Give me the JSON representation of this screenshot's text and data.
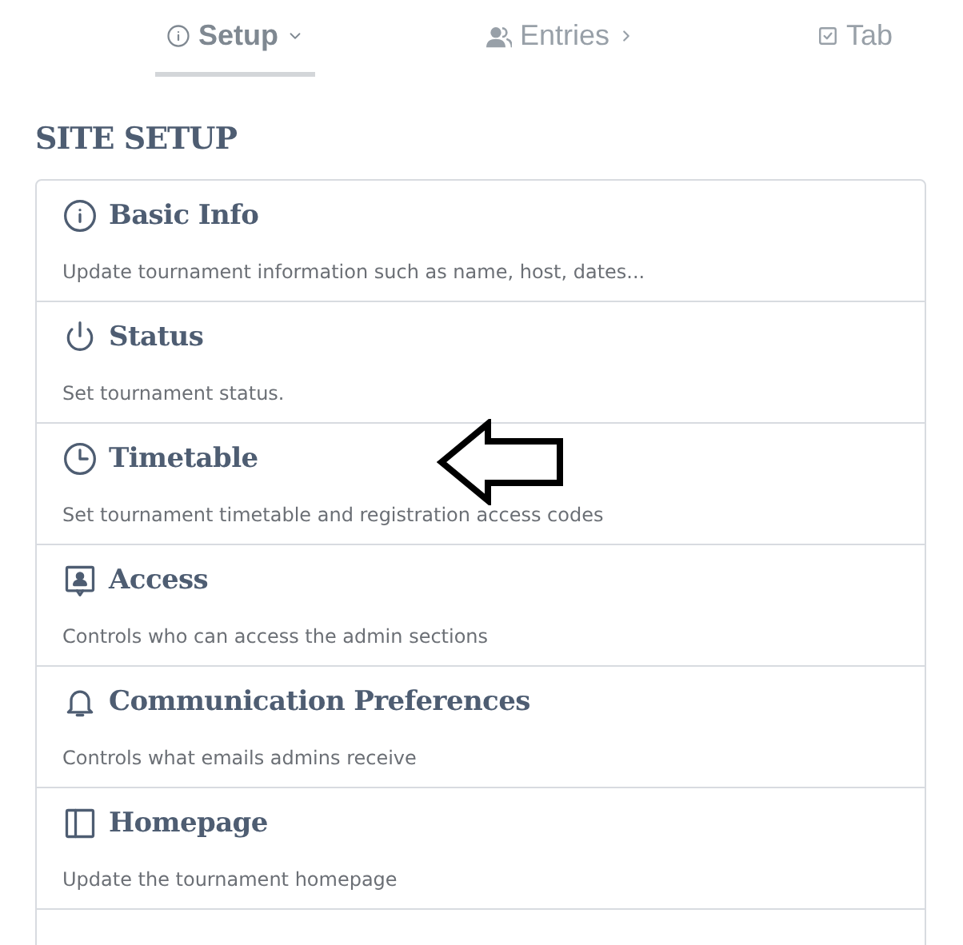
{
  "tabs": [
    {
      "label": "Setup",
      "selected": true,
      "expanded": true
    },
    {
      "label": "Entries",
      "selected": false,
      "expanded": false
    },
    {
      "label": "Tab",
      "selected": false
    }
  ],
  "heading": "SITE SETUP",
  "sections": [
    {
      "title": "Basic Info",
      "description": "Update tournament information such as name, host, dates..."
    },
    {
      "title": "Status",
      "description": "Set tournament status."
    },
    {
      "title": "Timetable",
      "description": "Set tournament timetable and registration access codes"
    },
    {
      "title": "Access",
      "description": "Controls who can access the admin sections"
    },
    {
      "title": "Communication Preferences",
      "description": "Controls what emails admins receive"
    },
    {
      "title": "Homepage",
      "description": "Update the tournament homepage"
    }
  ]
}
